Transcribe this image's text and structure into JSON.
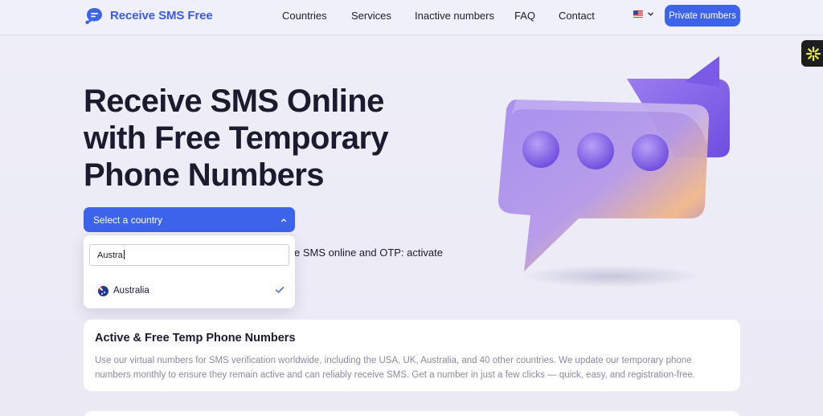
{
  "header": {
    "logo_text": "Receive SMS Free",
    "nav": [
      {
        "label": "Countries"
      },
      {
        "label": "Services"
      },
      {
        "label": "Inactive numbers"
      },
      {
        "label": "FAQ"
      },
      {
        "label": "Contact"
      }
    ],
    "language_icon": "us-flag-icon",
    "private_numbers_label": "Private numbers"
  },
  "hero": {
    "title": "Receive SMS Online with Free Temporary Phone Numbers",
    "select_country_label": "Select a country",
    "subtitle_fragment": "e SMS online and OTP: activate"
  },
  "dropdown": {
    "search_value": "Austra",
    "options": [
      {
        "label": "Australia",
        "selected": true,
        "icon": "australia-flag-icon"
      }
    ]
  },
  "info_card": {
    "title": "Active & Free Temp Phone Numbers",
    "body": "Use our virtual numbers for SMS verification worldwide, including the USA, UK, Australia, and 40 other countries. We update our temporary phone numbers monthly to ensure they remain active and can reliably receive SMS. Get a number in just a few clicks — quick, easy, and registration-free."
  },
  "colors": {
    "accent": "#3d63ea",
    "text": "#1b1b2f",
    "muted": "#8a8aa0"
  }
}
